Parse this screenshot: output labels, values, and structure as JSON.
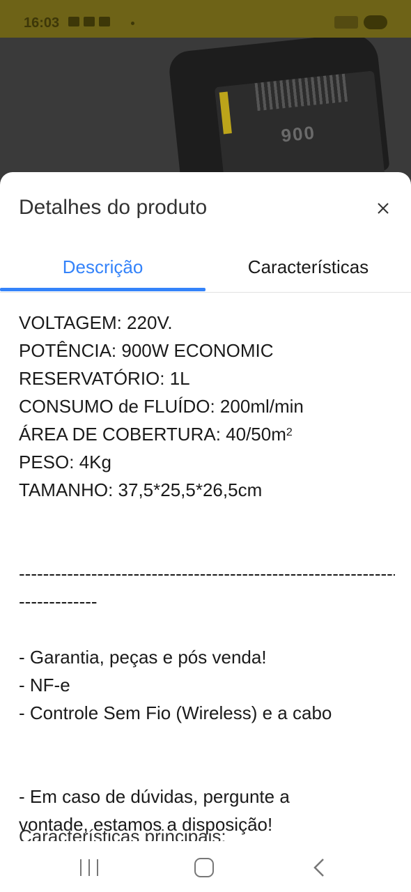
{
  "status_bar": {
    "time": "16:03"
  },
  "background_image": {
    "label_text": "900"
  },
  "sheet": {
    "title": "Detalhes do produto",
    "tabs": [
      {
        "label": "Descrição",
        "active": true
      },
      {
        "label": "Características",
        "active": false
      }
    ],
    "description": {
      "spec_lines": [
        "VOLTAGEM: 220V.",
        "POTÊNCIA: 900W ECONOMIC",
        "RESERVATÓRIO: 1L",
        "CONSUMO de FLUÍDO: 200ml/min"
      ],
      "area_label": "ÁREA DE COBERTURA: 40/50m",
      "area_superscript": "2",
      "spec_lines_2": [
        "PESO: 4Kg",
        "TAMANHO: 37,5*25,5*26,5cm"
      ],
      "dashes_1": "---------------------------------------------------------------",
      "dashes_2": "-------------",
      "bullets": [
        "- Garantia, peças e pós venda!",
        "- NF-e",
        "- Controle Sem Fio (Wireless) e a cabo"
      ],
      "doubts_1": "- Em caso de dúvidas, pergunte a",
      "doubts_2": "vontade, estamos a disposição!",
      "cut_line": "Características principais:"
    }
  },
  "colors": {
    "accent": "#3483fa",
    "status_bar": "#6e6317"
  },
  "icons": {
    "close": "close-icon",
    "nav_recent": "recent-apps-icon",
    "nav_home": "home-icon",
    "nav_back": "back-icon"
  }
}
